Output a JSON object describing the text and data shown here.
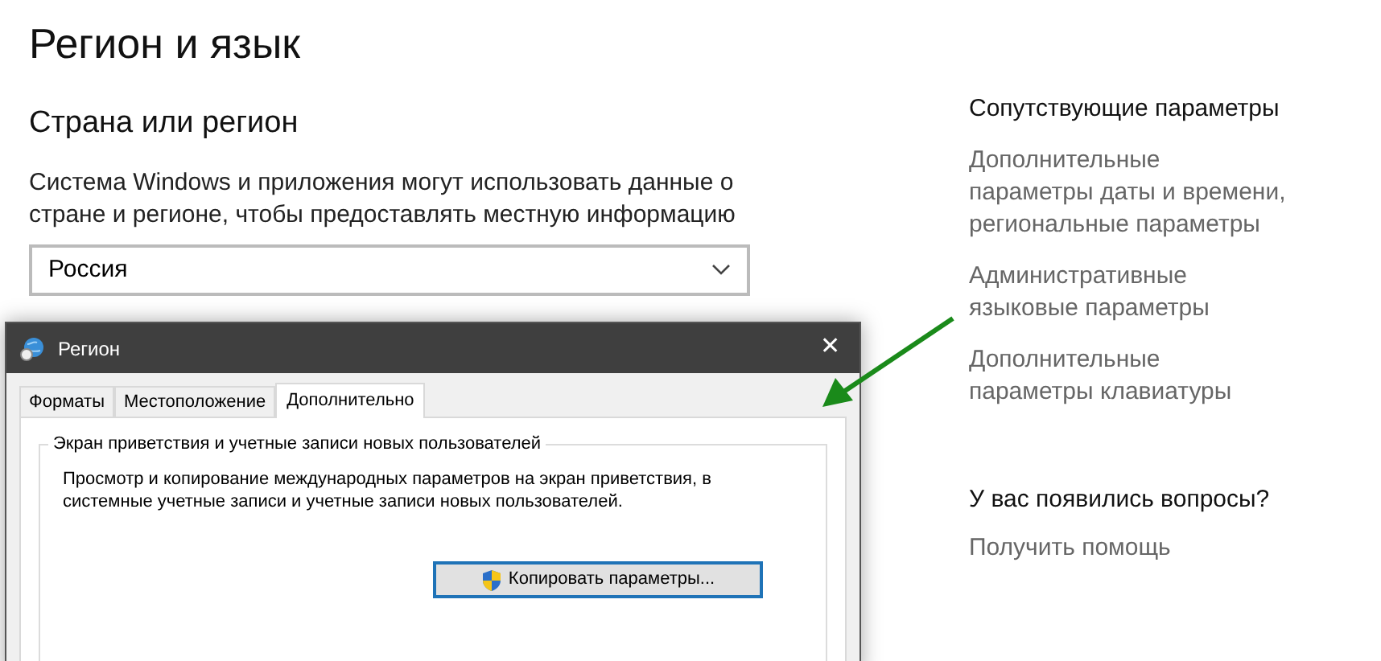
{
  "page": {
    "title": "Регион и язык",
    "section_title": "Страна или регион",
    "description": "Система Windows и приложения могут использовать данные о стране и регионе, чтобы предоставлять местную информацию",
    "country": {
      "value": "Россия"
    }
  },
  "related": {
    "heading": "Сопутствующие параметры",
    "links": [
      "Дополнительные параметры даты и времени, региональные параметры",
      "Административные языковые параметры",
      "Дополнительные параметры клавиатуры"
    ]
  },
  "help": {
    "heading": "У вас появились вопросы?",
    "link": "Получить помощь"
  },
  "dialog": {
    "title": "Регион",
    "close": "✕",
    "tabs": [
      {
        "label": "Форматы",
        "selected": false
      },
      {
        "label": "Местоположение",
        "selected": false
      },
      {
        "label": "Дополнительно",
        "selected": true
      }
    ],
    "group": {
      "title": "Экран приветствия и учетные записи новых пользователей",
      "text": "Просмотр и копирование международных параметров на экран приветствия, в системные учетные записи и учетные записи новых пользователей.",
      "button": "Копировать параметры..."
    }
  }
}
